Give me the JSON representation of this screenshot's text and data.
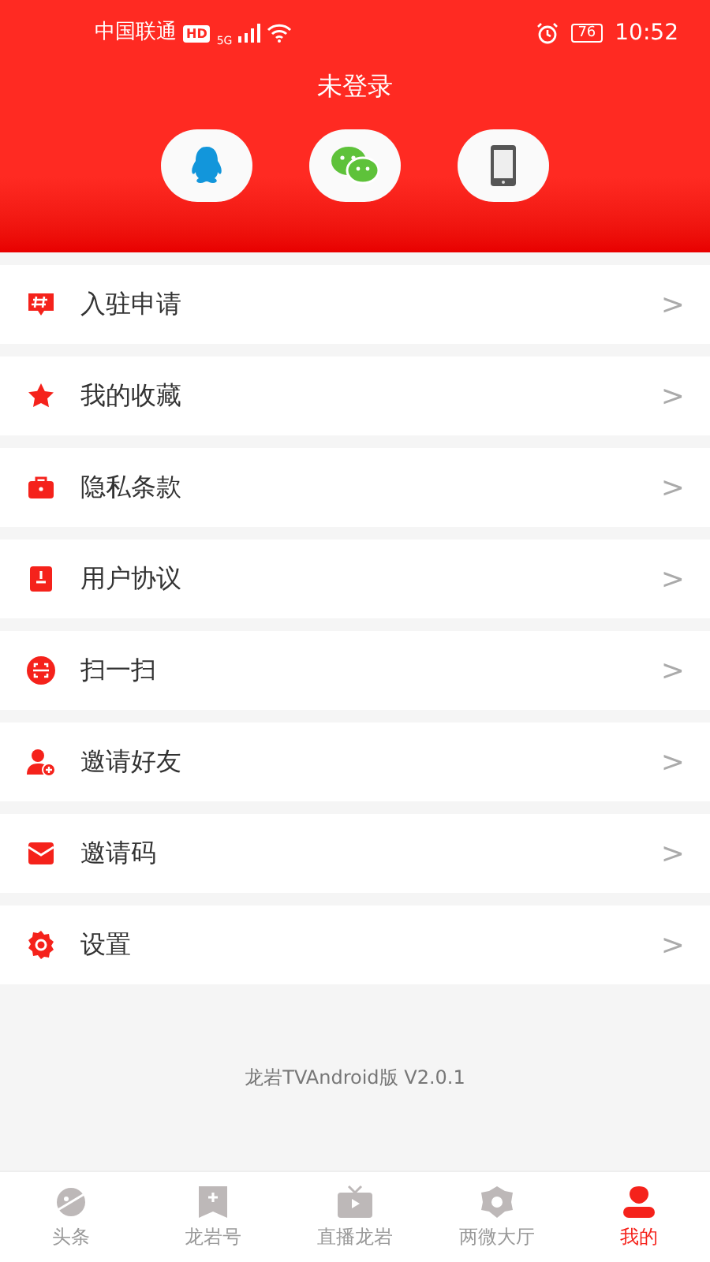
{
  "status_bar": {
    "carrier": "中国联通",
    "hd": "HD",
    "network": "5G",
    "battery": "76",
    "time": "10:52"
  },
  "header": {
    "title": "未登录",
    "login_buttons": [
      {
        "kind": "qq"
      },
      {
        "kind": "wechat"
      },
      {
        "kind": "phone"
      }
    ]
  },
  "menu": [
    {
      "kind": "apply",
      "label": "入驻申请",
      "chevron": ">"
    },
    {
      "kind": "star",
      "label": "我的收藏",
      "chevron": ">"
    },
    {
      "kind": "bag",
      "label": "隐私条款",
      "chevron": ">"
    },
    {
      "kind": "doc",
      "label": "用户协议",
      "chevron": ">"
    },
    {
      "kind": "scan",
      "label": "扫一扫",
      "chevron": ">"
    },
    {
      "kind": "invite",
      "label": "邀请好友",
      "chevron": ">"
    },
    {
      "kind": "mail",
      "label": "邀请码",
      "chevron": ">"
    },
    {
      "kind": "gear",
      "label": "设置",
      "chevron": ">"
    }
  ],
  "version": "龙岩TVAndroid版 V2.0.1",
  "tabs": [
    {
      "kind": "planet",
      "label": "头条",
      "selected": false
    },
    {
      "kind": "bookmark",
      "label": "龙岩号",
      "selected": false
    },
    {
      "kind": "tv",
      "label": "直播龙岩",
      "selected": false
    },
    {
      "kind": "hub",
      "label": "两微大厅",
      "selected": false
    },
    {
      "kind": "user",
      "label": "我的",
      "selected": true
    }
  ]
}
